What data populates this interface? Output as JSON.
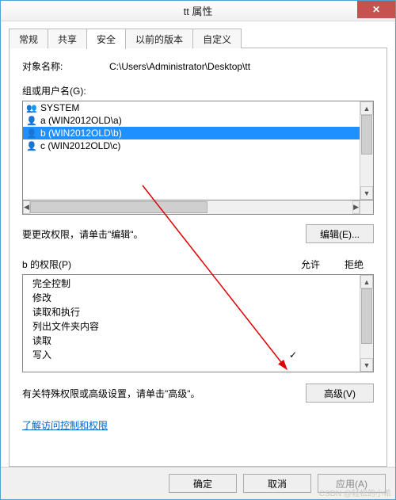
{
  "titlebar": {
    "title": "tt 属性",
    "close": "✕"
  },
  "tabs": [
    {
      "label": "常规",
      "active": false
    },
    {
      "label": "共享",
      "active": false
    },
    {
      "label": "安全",
      "active": true
    },
    {
      "label": "以前的版本",
      "active": false
    },
    {
      "label": "自定义",
      "active": false
    }
  ],
  "object": {
    "label": "对象名称:",
    "path": "C:\\Users\\Administrator\\Desktop\\tt"
  },
  "groups": {
    "label": "组或用户名(G):",
    "items": [
      {
        "icon": "system",
        "name": "SYSTEM",
        "selected": false
      },
      {
        "icon": "user",
        "name": "a (WIN2012OLD\\a)",
        "selected": false
      },
      {
        "icon": "user",
        "name": "b (WIN2012OLD\\b)",
        "selected": true
      },
      {
        "icon": "user",
        "name": "c (WIN2012OLD\\c)",
        "selected": false
      }
    ]
  },
  "edit": {
    "hint": "要更改权限，请单击\"编辑\"。",
    "button": "编辑(E)..."
  },
  "permissions": {
    "title": "b 的权限(P)",
    "allow": "允许",
    "deny": "拒绝",
    "rows": [
      {
        "name": "完全控制",
        "allow": "",
        "deny": ""
      },
      {
        "name": "修改",
        "allow": "",
        "deny": ""
      },
      {
        "name": "读取和执行",
        "allow": "",
        "deny": ""
      },
      {
        "name": "列出文件夹内容",
        "allow": "",
        "deny": ""
      },
      {
        "name": "读取",
        "allow": "",
        "deny": ""
      },
      {
        "name": "写入",
        "allow": "✓",
        "deny": ""
      }
    ]
  },
  "advanced": {
    "hint": "有关特殊权限或高级设置，请单击\"高级\"。",
    "button": "高级(V)"
  },
  "link": "了解访问控制和权限",
  "footer": {
    "ok": "确定",
    "cancel": "取消",
    "apply": "应用(A)"
  },
  "watermark": "CSDN @轻松的小希"
}
